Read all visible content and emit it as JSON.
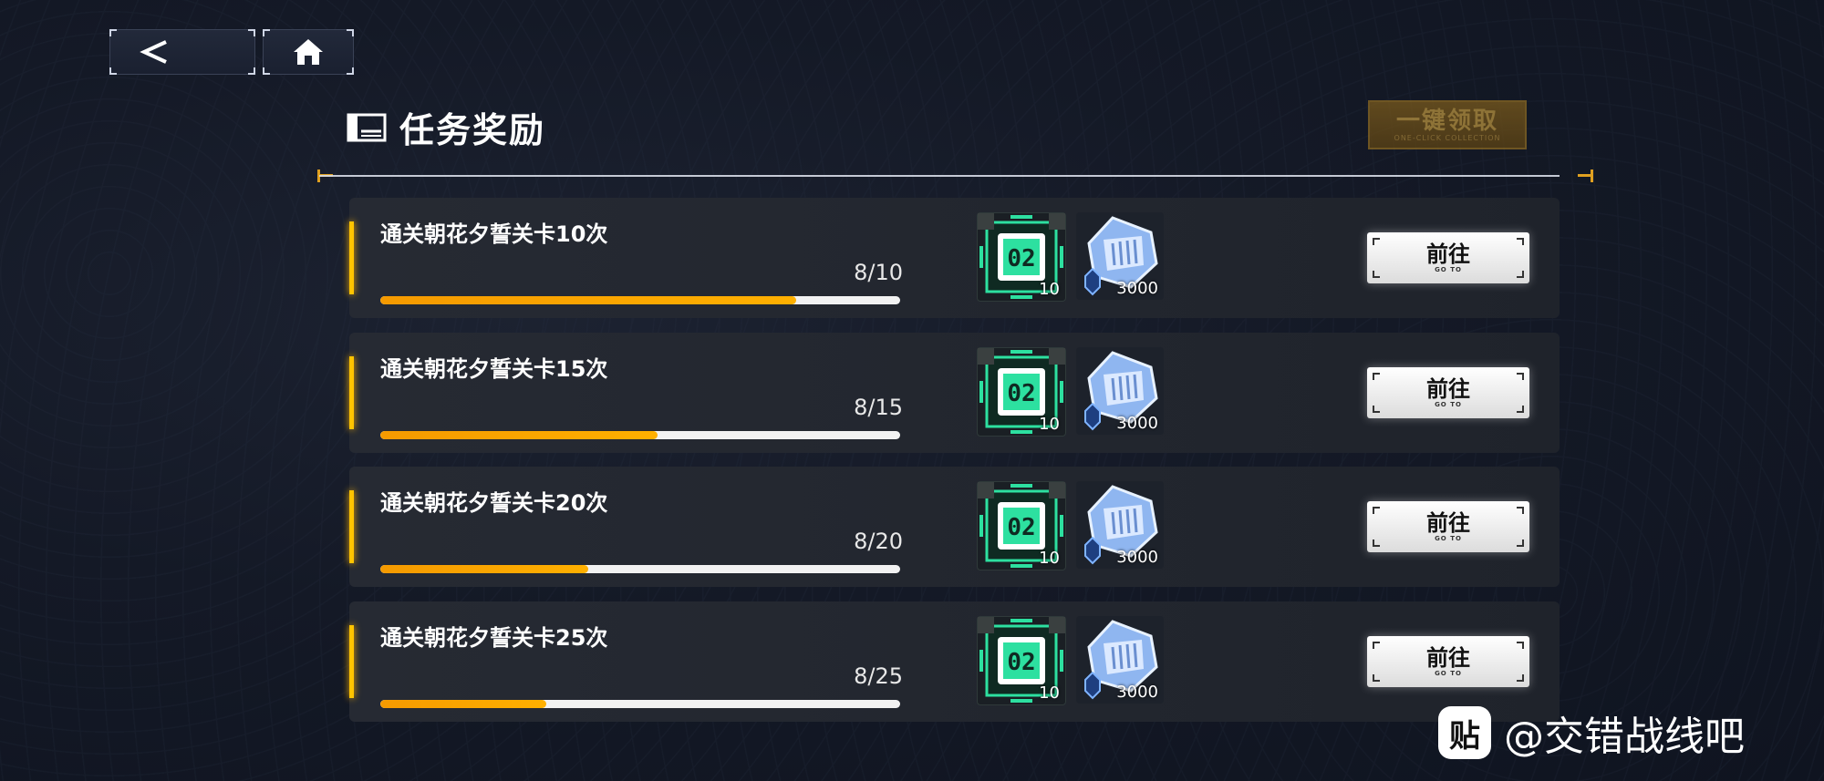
{
  "nav": {
    "back_icon": "chevron-left-icon",
    "home_icon": "home-icon"
  },
  "header": {
    "title": "任务奖励",
    "title_icon": "reward-list-icon",
    "claim_all_label": "一键领取",
    "claim_all_sub": "ONE-CLICK COLLECTION",
    "claim_all_enabled": false
  },
  "tasks": [
    {
      "name": "通关朝花夕誓关卡10次",
      "progress_text": "8/10",
      "progress": 0.8,
      "rewards": [
        {
          "icon": "chip-02-icon",
          "qty": "10"
        },
        {
          "icon": "crystal-icon",
          "qty": "3000"
        }
      ],
      "goto_label": "前往",
      "goto_sub": "GO TO"
    },
    {
      "name": "通关朝花夕誓关卡15次",
      "progress_text": "8/15",
      "progress": 0.533,
      "rewards": [
        {
          "icon": "chip-02-icon",
          "qty": "10"
        },
        {
          "icon": "crystal-icon",
          "qty": "3000"
        }
      ],
      "goto_label": "前往",
      "goto_sub": "GO TO"
    },
    {
      "name": "通关朝花夕誓关卡20次",
      "progress_text": "8/20",
      "progress": 0.4,
      "rewards": [
        {
          "icon": "chip-02-icon",
          "qty": "10"
        },
        {
          "icon": "crystal-icon",
          "qty": "3000"
        }
      ],
      "goto_label": "前往",
      "goto_sub": "GO TO"
    },
    {
      "name": "通关朝花夕誓关卡25次",
      "progress_text": "8/25",
      "progress": 0.32,
      "rewards": [
        {
          "icon": "chip-02-icon",
          "qty": "10"
        },
        {
          "icon": "crystal-icon",
          "qty": "3000"
        }
      ],
      "goto_label": "前往",
      "goto_sub": "GO TO"
    }
  ],
  "reward_chip_label": "02",
  "colors": {
    "accent": "#ffc400",
    "progress": "#f59a00",
    "chip": "#2de0a0",
    "crystal": "#9fc3ff"
  },
  "watermark": {
    "logo_char": "贴",
    "text": "@交错战线吧"
  }
}
